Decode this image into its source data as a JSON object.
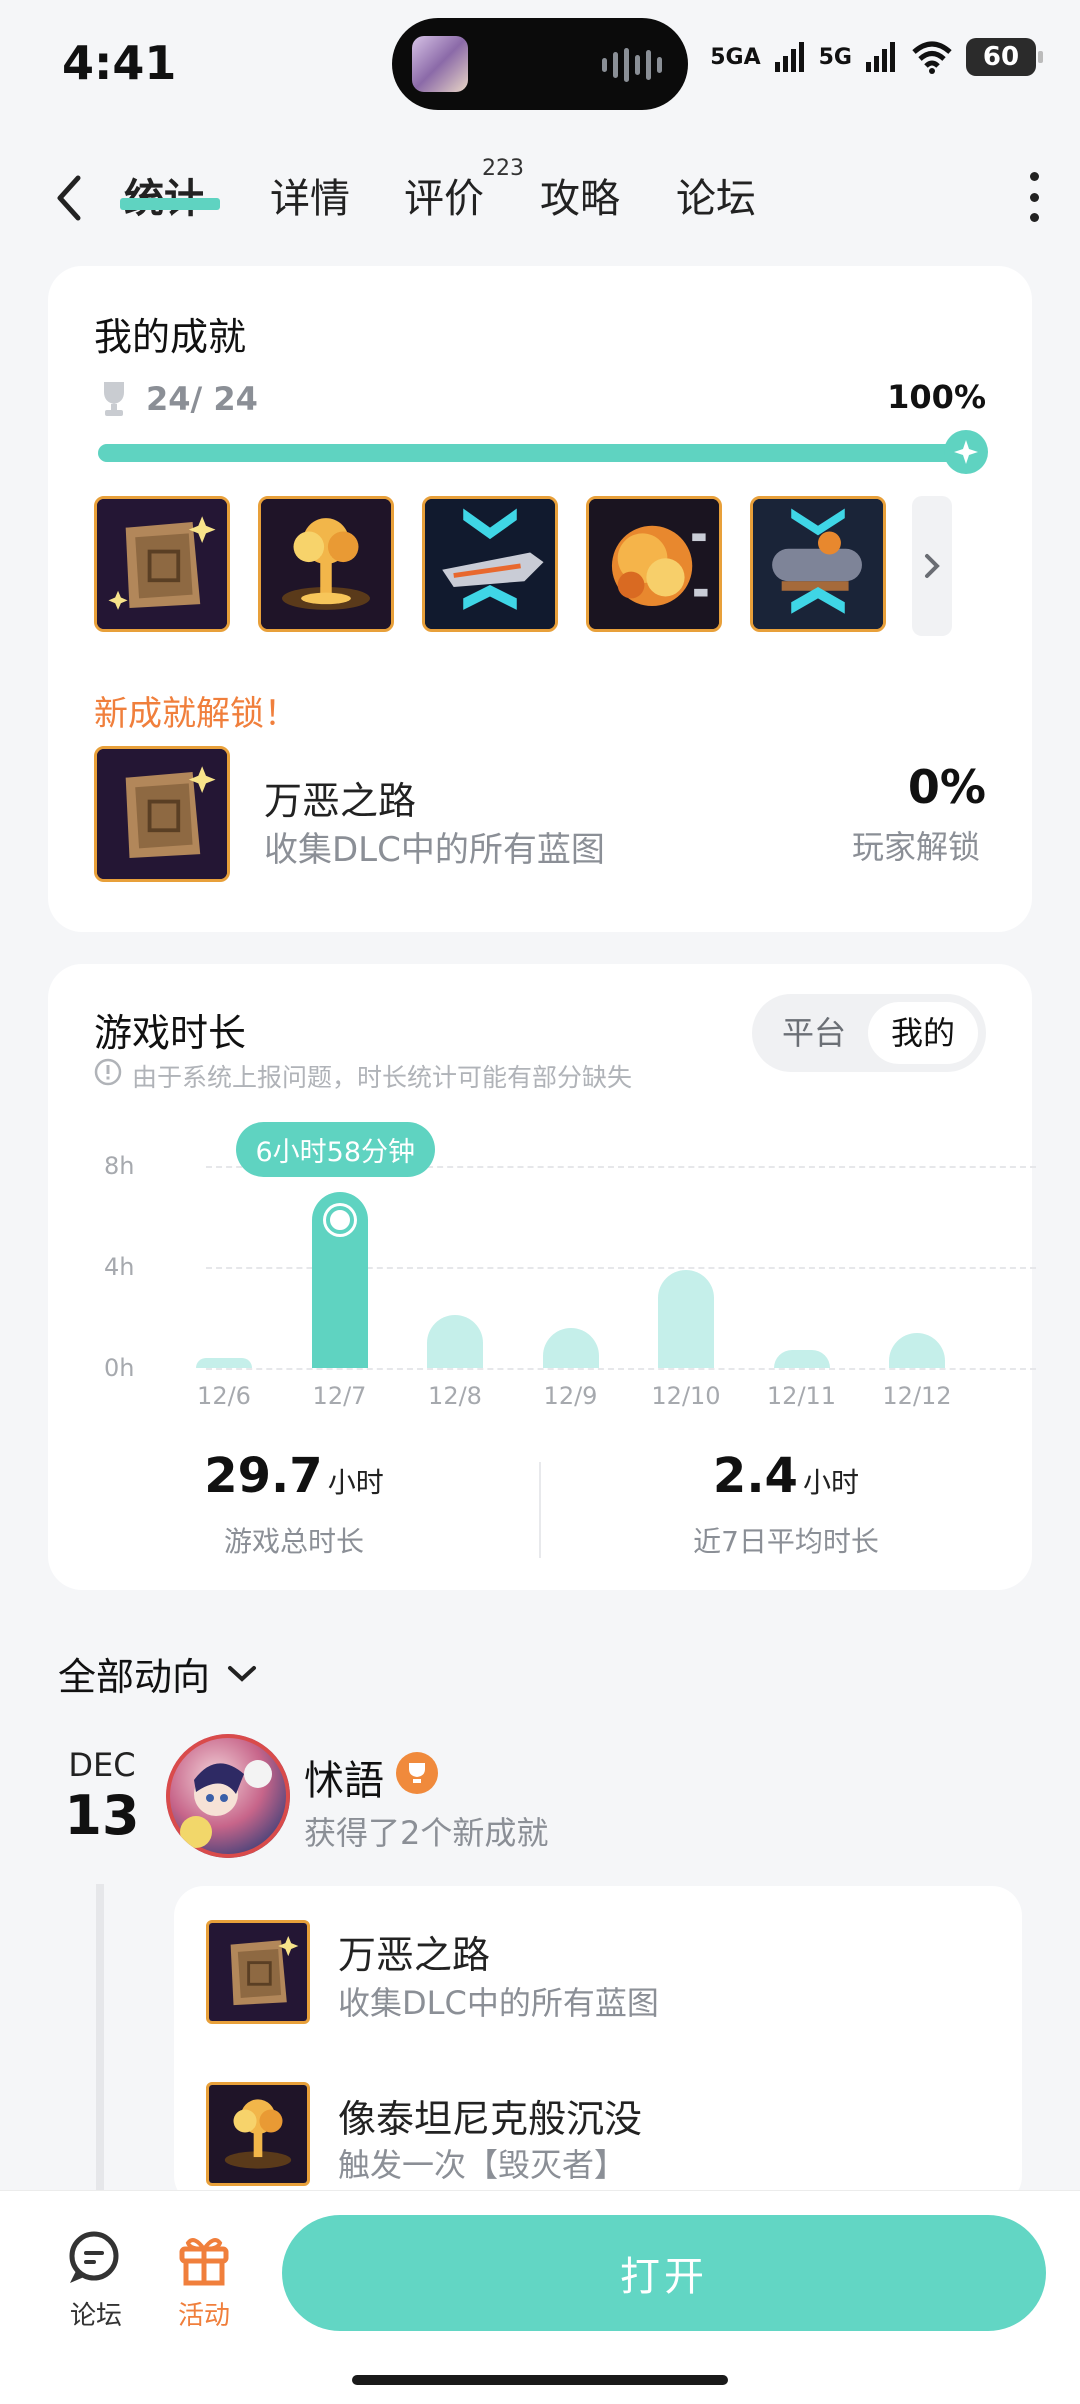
{
  "status_bar": {
    "time": "4:41",
    "network1": "5GA",
    "network2": "5G",
    "battery": "60"
  },
  "nav": {
    "tabs": [
      {
        "label": "统计"
      },
      {
        "label": "详情"
      },
      {
        "label": "评价",
        "badge": "223"
      },
      {
        "label": "攻略"
      },
      {
        "label": "论坛"
      }
    ]
  },
  "achievements": {
    "title": "我的成就",
    "count": "24/ 24",
    "percent_label": "100%",
    "progress": 1.0,
    "icons": [
      "blueprint-map-icon",
      "explosion-cloud-icon",
      "spaceship-icon",
      "fireball-icon",
      "submarine-icon"
    ],
    "new_unlock_label": "新成就解锁！",
    "unlocked": {
      "name": "万恶之路",
      "desc": "收集DLC中的所有蓝图",
      "rate": "0%",
      "rate_label": "玩家解锁"
    }
  },
  "playtime": {
    "title": "游戏时长",
    "notice": "由于系统上报问题，时长统计可能有部分缺失",
    "toggle": [
      "平台",
      "我的"
    ],
    "tooltip": "6小时58分钟",
    "total_value": "29.7",
    "total_unit": "小时",
    "total_label": "游戏总时长",
    "avg_value": "2.4",
    "avg_unit": "小时",
    "avg_label": "近7日平均时长"
  },
  "chart_data": {
    "type": "bar",
    "categories": [
      "12/6",
      "12/7",
      "12/8",
      "12/9",
      "12/10",
      "12/11",
      "12/12"
    ],
    "values": [
      0.4,
      6.97,
      2.1,
      1.6,
      3.9,
      0.7,
      1.4
    ],
    "y_ticks": [
      "8h",
      "4h",
      "0h"
    ],
    "ylim": [
      0,
      8
    ],
    "highlight_index": 1,
    "colors": {
      "highlight": "#5fd3c1",
      "normal": "#c5efea"
    }
  },
  "feed": {
    "filter_label": "全部动向",
    "entry": {
      "month": "DEC",
      "day": "13",
      "user": "怵語",
      "action": "获得了2个新成就",
      "items": [
        {
          "name": "万恶之路",
          "desc": "收集DLC中的所有蓝图"
        },
        {
          "name": "像泰坦尼克般沉没",
          "desc": "触发一次【毁灭者】"
        }
      ]
    }
  },
  "bottom": {
    "forum_label": "论坛",
    "activity_label": "活动",
    "open_label": "打开"
  }
}
